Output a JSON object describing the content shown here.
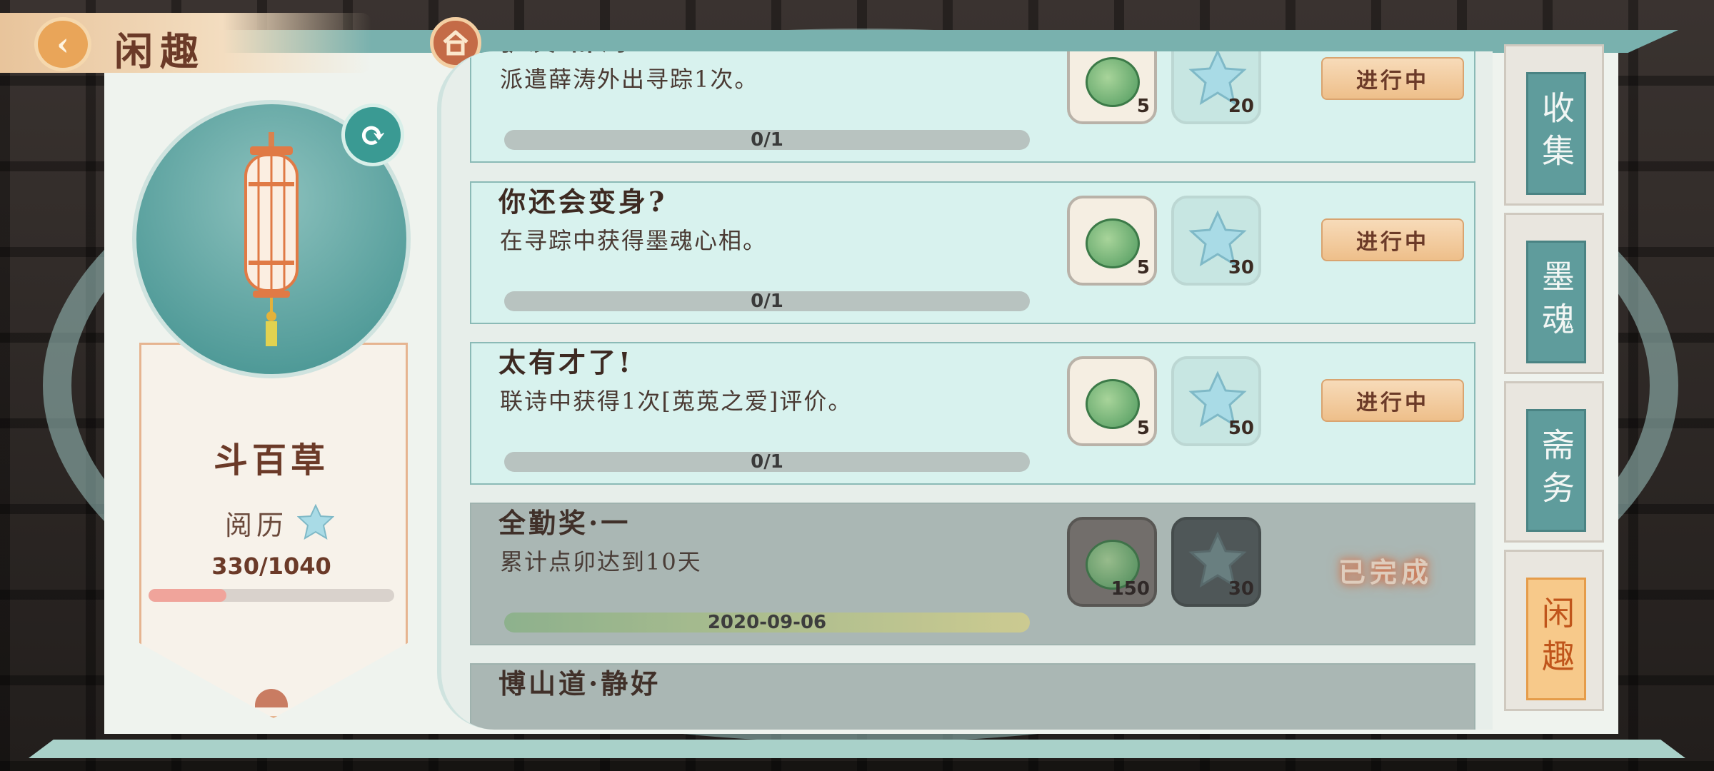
{
  "header": {
    "title": "闲趣",
    "back_icon": "chevron-left-icon",
    "home_icon": "home-icon"
  },
  "profile": {
    "name": "斗百草",
    "exp_label": "阅历",
    "exp_value": "330/1040",
    "exp_progress": 0.317,
    "refresh_icon": "refresh-icon"
  },
  "tasks": [
    {
      "title": "驴友·薛涛",
      "desc": "派遣薛涛外出寻踪1次。",
      "progress": "0/1",
      "coin": "5",
      "star": "20",
      "status": "进行中",
      "done": false
    },
    {
      "title": "你还会变身?",
      "desc": "在寻踪中获得墨魂心相。",
      "progress": "0/1",
      "coin": "5",
      "star": "30",
      "status": "进行中",
      "done": false
    },
    {
      "title": "太有才了!",
      "desc": "联诗中获得1次[莵莵之爱]评价。",
      "progress": "0/1",
      "coin": "5",
      "star": "50",
      "status": "进行中",
      "done": false
    },
    {
      "title": "全勤奖·一",
      "desc": "累计点卯达到10天",
      "progress": "2020-09-06",
      "coin": "150",
      "star": "30",
      "status": "已完成",
      "done": true
    },
    {
      "title": "博山道·静好",
      "desc": "",
      "progress": "",
      "coin": "",
      "star": "",
      "status": "",
      "done": true
    }
  ],
  "side_tabs": [
    {
      "label": "收集",
      "active": false
    },
    {
      "label": "墨魂",
      "active": false
    },
    {
      "label": "斋务",
      "active": false
    },
    {
      "label": "闲趣",
      "active": true
    }
  ],
  "colors": {
    "accent": "#5f9c9c",
    "title_brown": "#6b3a28",
    "status_btn": "#eebf8a",
    "done_glow": "#f07a4a"
  }
}
